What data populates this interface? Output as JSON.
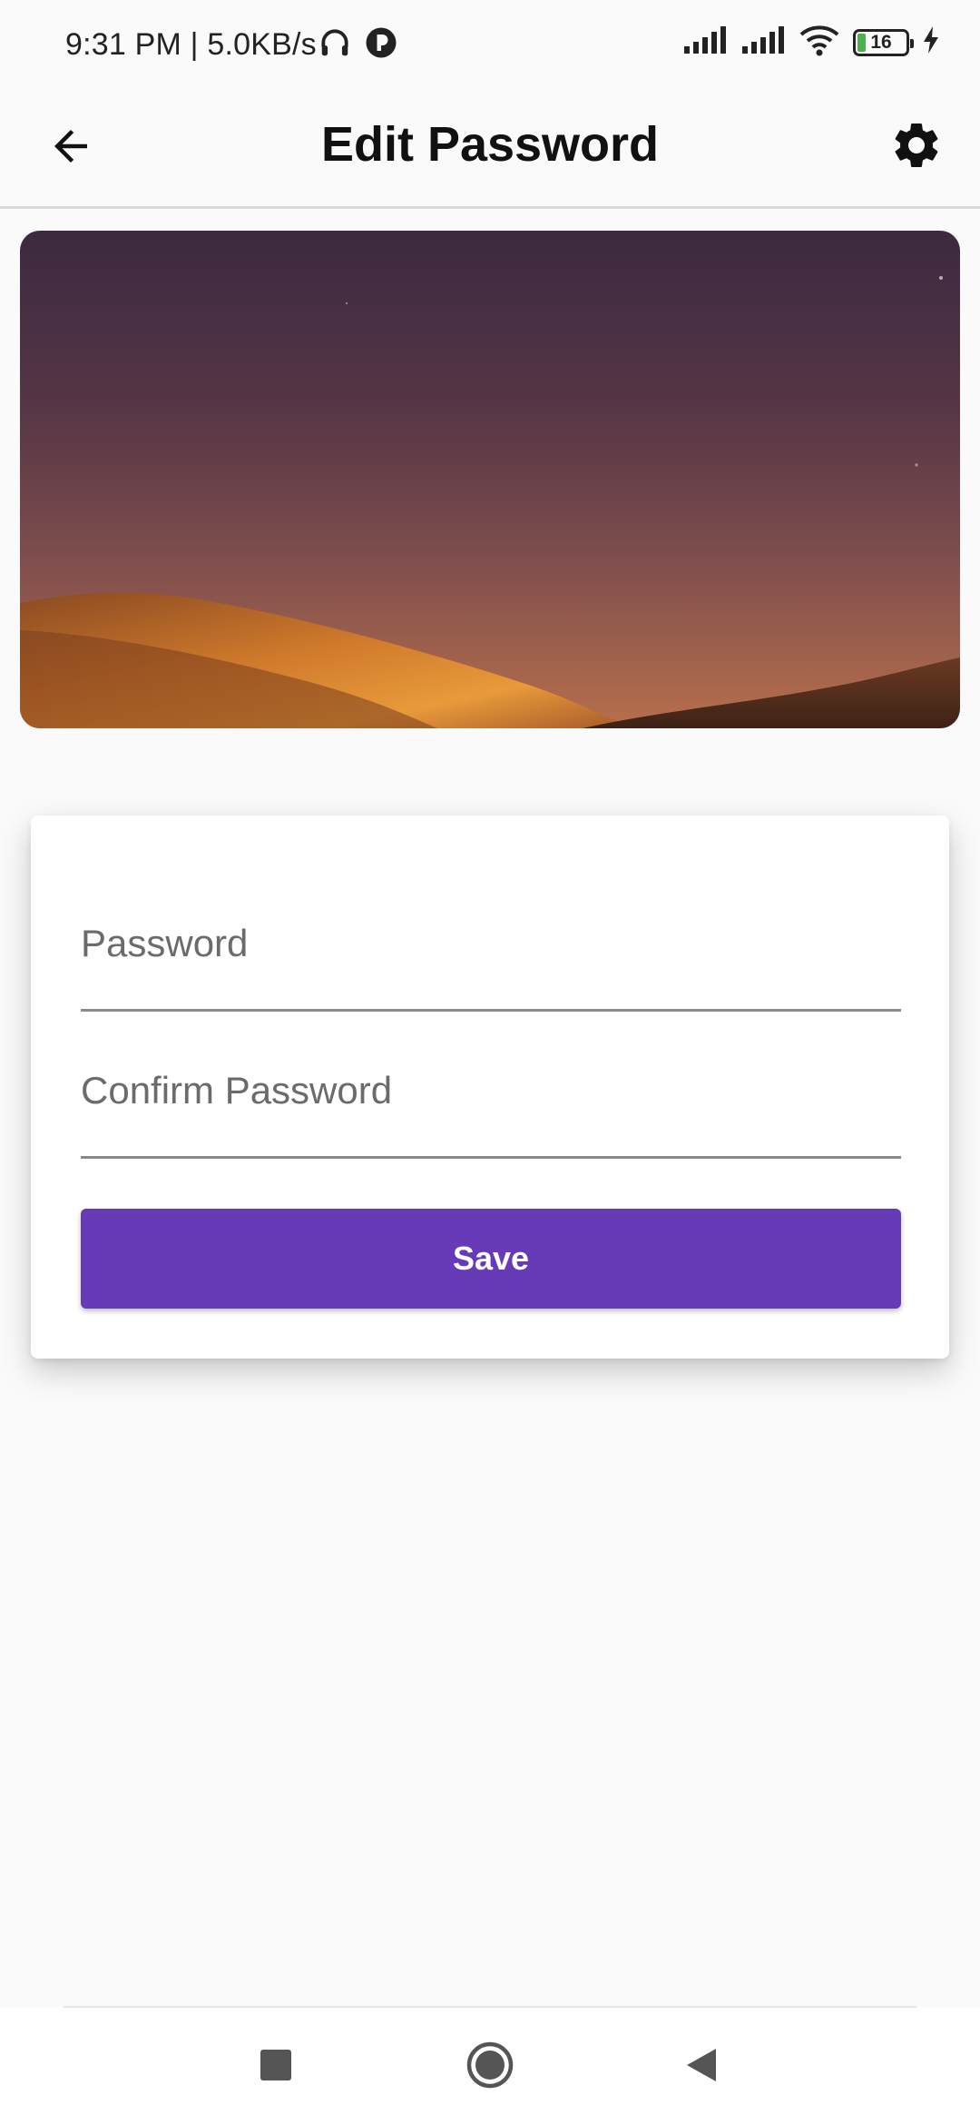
{
  "status_bar": {
    "time": "9:31 PM | 5.0KB/s",
    "battery_level": "16",
    "icons": [
      "headphones-icon",
      "app-notification-icon",
      "signal-icon",
      "signal-icon",
      "wifi-icon",
      "battery-icon",
      "charging-icon"
    ]
  },
  "app_bar": {
    "title": "Edit Password",
    "back_icon": "arrow-back-icon",
    "settings_icon": "gear-icon"
  },
  "form": {
    "password_placeholder": "Password",
    "password_value": "",
    "confirm_placeholder": "Confirm Password",
    "confirm_value": "",
    "save_label": "Save"
  },
  "nav_bar": {
    "icons": [
      "recents-square-icon",
      "home-circle-icon",
      "back-triangle-icon"
    ]
  },
  "colors": {
    "primary": "#673ab7",
    "background": "#fafafa",
    "card": "#ffffff"
  }
}
